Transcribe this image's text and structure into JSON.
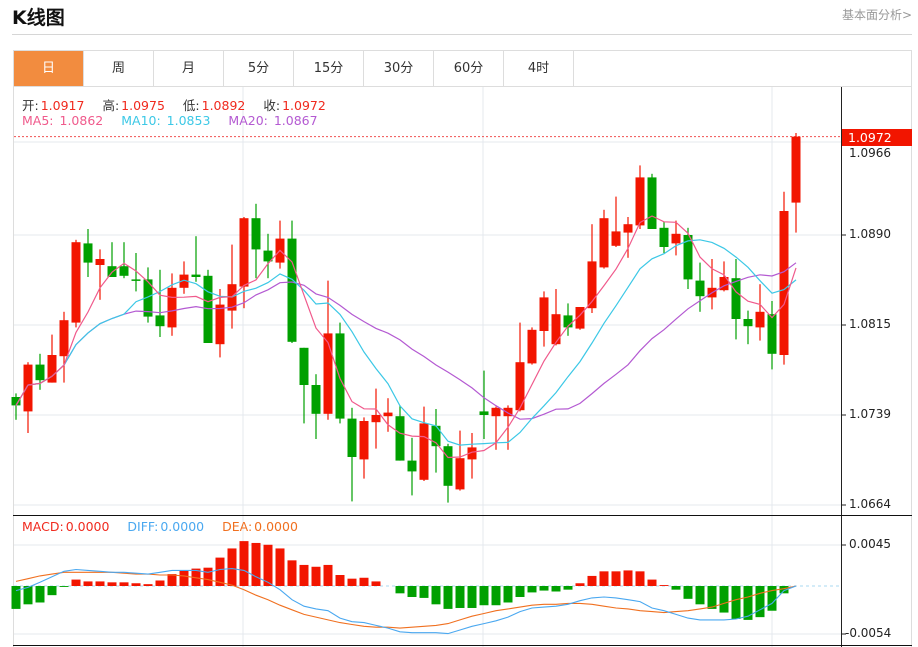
{
  "header": {
    "title": "K线图",
    "link": "基本面分析>"
  },
  "tabs": [
    {
      "label": "日",
      "active": true
    },
    {
      "label": "周"
    },
    {
      "label": "月"
    },
    {
      "label": "5分"
    },
    {
      "label": "15分"
    },
    {
      "label": "30分"
    },
    {
      "label": "60分"
    },
    {
      "label": "4时"
    }
  ],
  "info": {
    "open_label": "开:",
    "open": "1.0917",
    "high_label": "高:",
    "high": "1.0975",
    "low_label": "低:",
    "low": "1.0892",
    "close_label": "收:",
    "close": "1.0972",
    "ma5_label": "MA5:",
    "ma5": "1.0862",
    "ma10_label": "MA10:",
    "ma10": "1.0853",
    "ma20_label": "MA20:",
    "ma20": "1.0867"
  },
  "macd_info": {
    "macd_label": "MACD:",
    "macd": "0.0000",
    "diff_label": "DIFF:",
    "diff": "0.0000",
    "dea_label": "DEA:",
    "dea": "0.0000"
  },
  "current_price": "1.0972",
  "price_axis": [
    "1.0966",
    "1.0890",
    "1.0815",
    "1.0739",
    "1.0664"
  ],
  "macd_axis": [
    "0.0045",
    "-0.0054"
  ],
  "colors": {
    "up": "#f21500",
    "down": "#00a000",
    "ma5": "#f05a8c",
    "ma10": "#3cc8e6",
    "ma20": "#b45ad2",
    "diff": "#4aa8f0",
    "dea": "#f07020",
    "accent": "#f28c3f"
  },
  "chart_data": {
    "type": "candlestick",
    "price_range": [
      1.064,
      1.0985
    ],
    "candles": [
      [
        1.0755,
        1.0758,
        1.0736,
        1.0748
      ],
      [
        1.0743,
        1.0784,
        1.0725,
        1.0782
      ],
      [
        1.0782,
        1.0791,
        1.0761,
        1.0769
      ],
      [
        1.0767,
        1.0807,
        1.0767,
        1.079
      ],
      [
        1.0789,
        1.0826,
        1.0767,
        1.0819
      ],
      [
        1.0817,
        1.0886,
        1.0813,
        1.0884
      ],
      [
        1.0883,
        1.0895,
        1.0855,
        1.0867
      ],
      [
        1.0865,
        1.0878,
        1.0836,
        1.087
      ],
      [
        1.0864,
        1.0884,
        1.0855,
        1.0855
      ],
      [
        1.0864,
        1.0884,
        1.0854,
        1.0856
      ],
      [
        1.0853,
        1.0875,
        1.0843,
        1.0852
      ],
      [
        1.0853,
        1.0863,
        1.0817,
        1.0822
      ],
      [
        1.0823,
        1.0861,
        1.0805,
        1.0814
      ],
      [
        1.0813,
        1.0858,
        1.0806,
        1.0846
      ],
      [
        1.0846,
        1.0868,
        1.0841,
        1.0857
      ],
      [
        1.0857,
        1.0889,
        1.0851,
        1.0855
      ],
      [
        1.0856,
        1.0861,
        1.08,
        1.08
      ],
      [
        1.0799,
        1.0845,
        1.0788,
        1.0832
      ],
      [
        1.0827,
        1.0882,
        1.0812,
        1.0849
      ],
      [
        1.0847,
        1.0905,
        1.0829,
        1.0904
      ],
      [
        1.0904,
        1.0916,
        1.0854,
        1.0878
      ],
      [
        1.0877,
        1.0891,
        1.0854,
        1.0868
      ],
      [
        1.0867,
        1.0902,
        1.0862,
        1.0887
      ],
      [
        1.0887,
        1.0902,
        1.08,
        1.0801
      ],
      [
        1.0796,
        1.0796,
        1.0733,
        1.0765
      ],
      [
        1.0765,
        1.0774,
        1.072,
        1.0741
      ],
      [
        1.0741,
        1.0852,
        1.0736,
        1.0808
      ],
      [
        1.0808,
        1.0817,
        1.0733,
        1.0737
      ],
      [
        1.0737,
        1.0746,
        1.0668,
        1.0705
      ],
      [
        1.0703,
        1.0738,
        1.0687,
        1.0735
      ],
      [
        1.0734,
        1.0762,
        1.0712,
        1.074
      ],
      [
        1.0739,
        1.0754,
        1.0726,
        1.0742
      ],
      [
        1.0739,
        1.0748,
        1.0702,
        1.0702
      ],
      [
        1.0702,
        1.0721,
        1.0673,
        1.0693
      ],
      [
        1.0686,
        1.0747,
        1.0685,
        1.0733
      ],
      [
        1.0731,
        1.0745,
        1.0692,
        1.0714
      ],
      [
        1.0714,
        1.0716,
        1.0667,
        1.0681
      ],
      [
        1.0678,
        1.0727,
        1.0677,
        1.0704
      ],
      [
        1.0703,
        1.0725,
        1.0687,
        1.0713
      ],
      [
        1.0743,
        1.0777,
        1.072,
        1.074
      ],
      [
        1.0739,
        1.0747,
        1.0711,
        1.0746
      ],
      [
        1.0739,
        1.0748,
        1.0711,
        1.0746
      ],
      [
        1.0744,
        1.0817,
        1.0743,
        1.0784
      ],
      [
        1.0783,
        1.0813,
        1.0782,
        1.0811
      ],
      [
        1.081,
        1.0843,
        1.0797,
        1.0838
      ],
      [
        1.0799,
        1.0845,
        1.0798,
        1.0824
      ],
      [
        1.0823,
        1.0833,
        1.0806,
        1.0813
      ],
      [
        1.0812,
        1.083,
        1.0811,
        1.083
      ],
      [
        1.0829,
        1.0899,
        1.0825,
        1.0868
      ],
      [
        1.0863,
        1.0911,
        1.0862,
        1.0904
      ],
      [
        1.0881,
        1.0922,
        1.088,
        1.0893
      ],
      [
        1.0892,
        1.0905,
        1.0871,
        1.0899
      ],
      [
        1.0898,
        1.0948,
        1.0895,
        1.0938
      ],
      [
        1.0938,
        1.0941,
        1.0895,
        1.0895
      ],
      [
        1.0896,
        1.0901,
        1.0875,
        1.088
      ],
      [
        1.0883,
        1.0902,
        1.0873,
        1.0891
      ],
      [
        1.089,
        1.0896,
        1.0845,
        1.0853
      ],
      [
        1.0852,
        1.0867,
        1.0826,
        1.0839
      ],
      [
        1.0838,
        1.087,
        1.0828,
        1.0846
      ],
      [
        1.0844,
        1.0868,
        1.0843,
        1.0855
      ],
      [
        1.0854,
        1.087,
        1.0803,
        1.082
      ],
      [
        1.082,
        1.0827,
        1.0799,
        1.0814
      ],
      [
        1.0813,
        1.0849,
        1.0802,
        1.0826
      ],
      [
        1.0824,
        1.0835,
        1.0778,
        1.0791
      ],
      [
        1.079,
        1.0926,
        1.0782,
        1.091
      ],
      [
        1.0917,
        1.0975,
        1.0892,
        1.0972
      ]
    ],
    "candle_fields": [
      "open",
      "high",
      "low",
      "close"
    ],
    "macd_range": [
      -0.0054,
      0.0045
    ],
    "macd_hist": [
      -0.0025,
      -0.002,
      -0.0018,
      -0.001,
      -0.0001,
      0.0007,
      0.0005,
      0.0005,
      0.0004,
      0.0004,
      0.0003,
      0.0002,
      0.0006,
      0.0013,
      0.0017,
      0.0019,
      0.002,
      0.0031,
      0.0041,
      0.0049,
      0.0047,
      0.0045,
      0.0041,
      0.0028,
      0.0023,
      0.0021,
      0.0023,
      0.0012,
      0.0008,
      0.0009,
      0.0005,
      0.0,
      -0.0008,
      -0.0012,
      -0.0013,
      -0.002,
      -0.0025,
      -0.0024,
      -0.0024,
      -0.0021,
      -0.0021,
      -0.0018,
      -0.0012,
      -0.0007,
      -0.0005,
      -0.0006,
      -0.0004,
      0.0003,
      0.0011,
      0.0016,
      0.0016,
      0.0017,
      0.0016,
      0.0007,
      0.0001,
      -0.0004,
      -0.0014,
      -0.002,
      -0.0025,
      -0.0029,
      -0.0036,
      -0.0037,
      -0.0034,
      -0.0027,
      -0.0008,
      0.0
    ],
    "diff": [
      -0.0005,
      -0.00015,
      0.0004,
      0.001,
      0.0016,
      0.0018,
      0.0017,
      0.0016,
      0.0015,
      0.0015,
      0.0014,
      0.0013,
      0.0015,
      0.0017,
      0.0017,
      0.0017,
      0.0015,
      0.0018,
      0.0019,
      0.0017,
      0.001,
      0.0004,
      -0.0004,
      -0.0015,
      -0.0022,
      -0.0025,
      -0.0027,
      -0.0035,
      -0.0039,
      -0.004,
      -0.0043,
      -0.0046,
      -0.005,
      -0.0051,
      -0.0051,
      -0.0051,
      -0.0052,
      -0.0048,
      -0.0044,
      -0.0041,
      -0.0038,
      -0.0034,
      -0.0028,
      -0.0024,
      -0.0023,
      -0.0022,
      -0.002,
      -0.0016,
      -0.0013,
      -0.0012,
      -0.0013,
      -0.0015,
      -0.0017,
      -0.0024,
      -0.0027,
      -0.0031,
      -0.0035,
      -0.0037,
      -0.0037,
      -0.0037,
      -0.0036,
      -0.0033,
      -0.0026,
      -0.0019,
      -0.0005,
      0.0
    ],
    "dea": [
      0.0005,
      0.0008,
      0.0011,
      0.0013,
      0.0015,
      0.0015,
      0.0015,
      0.0015,
      0.0015,
      0.0014,
      0.0013,
      0.0013,
      0.0012,
      0.0012,
      0.0011,
      0.0009,
      0.0007,
      0.0004,
      0.0001,
      -0.0004,
      -0.001,
      -0.0015,
      -0.0021,
      -0.0026,
      -0.0031,
      -0.0034,
      -0.0037,
      -0.004,
      -0.0042,
      -0.0044,
      -0.0045,
      -0.0045,
      -0.0046,
      -0.0045,
      -0.0044,
      -0.0043,
      -0.0041,
      -0.0037,
      -0.0033,
      -0.003,
      -0.0027,
      -0.0025,
      -0.0023,
      -0.0021,
      -0.002,
      -0.002,
      -0.0019,
      -0.0019,
      -0.002,
      -0.0022,
      -0.0024,
      -0.0025,
      -0.0027,
      -0.0028,
      -0.0029,
      -0.0028,
      -0.0027,
      -0.0025,
      -0.0023,
      -0.0019,
      -0.0015,
      -0.0012,
      -0.0008,
      -0.0005,
      -0.0003,
      0.0
    ]
  }
}
